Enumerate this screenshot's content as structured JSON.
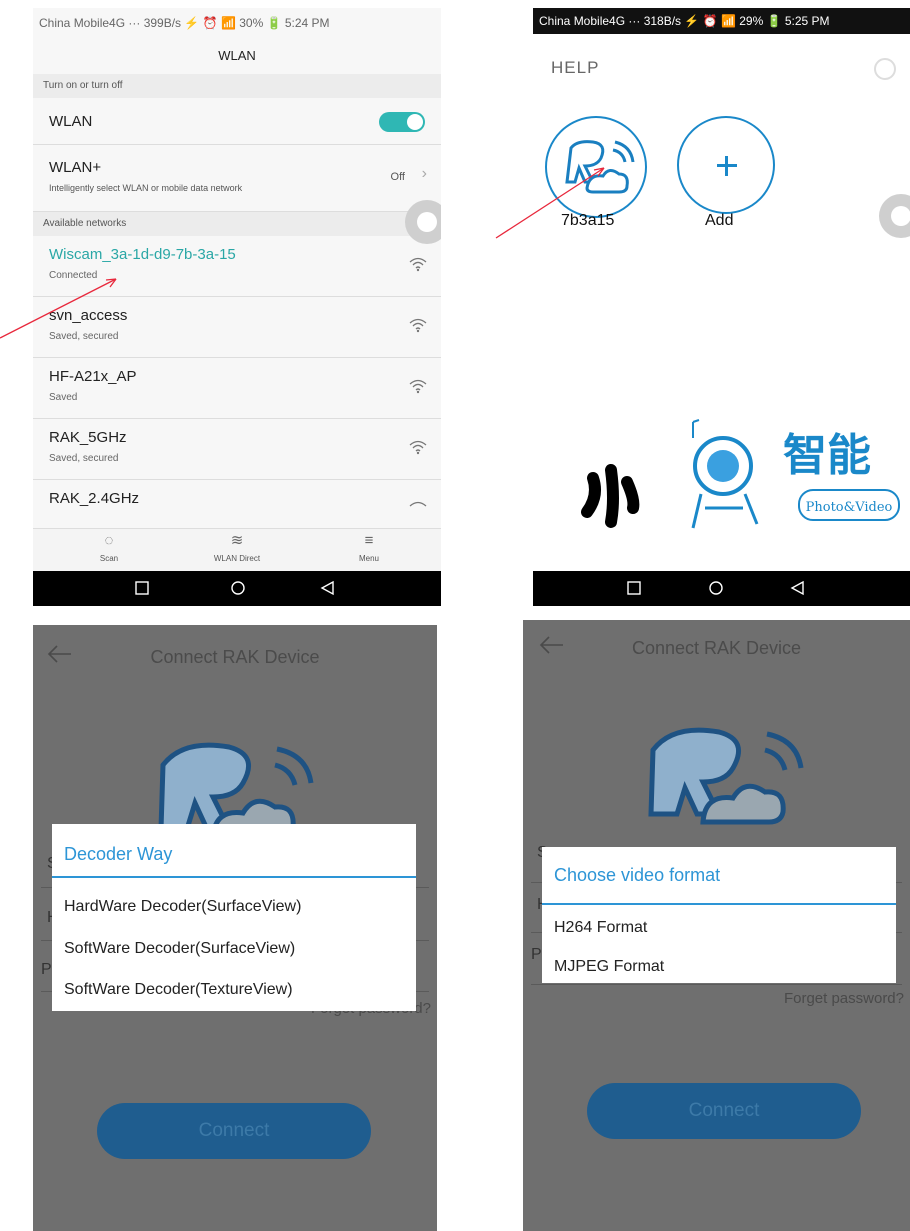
{
  "wlan": {
    "status": "China Mobile4G ··· 399B/s ⚡ ⏰ 📶 30% 🔋 5:24 PM",
    "title": "WLAN",
    "section_toggle": "Turn on or turn off",
    "wlan_label": "WLAN",
    "wlanplus_label": "WLAN+",
    "wlanplus_desc": "Intelligently select WLAN or mobile data network",
    "wlanplus_value": "Off",
    "section_networks": "Available networks",
    "networks": [
      {
        "ssid": "Wiscam_3a-1d-d9-7b-3a-15",
        "status": "Connected"
      },
      {
        "ssid": "svn_access",
        "status": "Saved, secured"
      },
      {
        "ssid": "HF-A21x_AP",
        "status": "Saved"
      },
      {
        "ssid": "RAK_5GHz",
        "status": "Saved, secured"
      },
      {
        "ssid": "RAK_2.4GHz",
        "status": ""
      }
    ],
    "bottom": {
      "scan": "Scan",
      "direct": "WLAN Direct",
      "menu": "Menu"
    }
  },
  "help": {
    "status": "China Mobile4G ··· 318B/s ⚡ ⏰ 📶 29% 🔋 5:25 PM",
    "title": "HELP",
    "device_label": "7b3a15",
    "add_label": "Add",
    "logo_text": "Photo&Video"
  },
  "decoder": {
    "title": "Connect RAK Device",
    "dialog_title": "Decoder Way",
    "options": [
      "HardWare Decoder(SurfaceView)",
      "SoftWare Decoder(SurfaceView)",
      "SoftWare Decoder(TextureView)"
    ],
    "forgot": "Forget password?",
    "connect": "Connect"
  },
  "format": {
    "title": "Connect RAK Device",
    "dialog_title": "Choose video format",
    "options": [
      "H264 Format",
      "MJPEG Format"
    ],
    "forgot": "Forget password?",
    "connect": "Connect"
  },
  "colors": {
    "accent": "#2d95d6",
    "teal": "#2fb7b4",
    "arrow": "#e8283c"
  }
}
